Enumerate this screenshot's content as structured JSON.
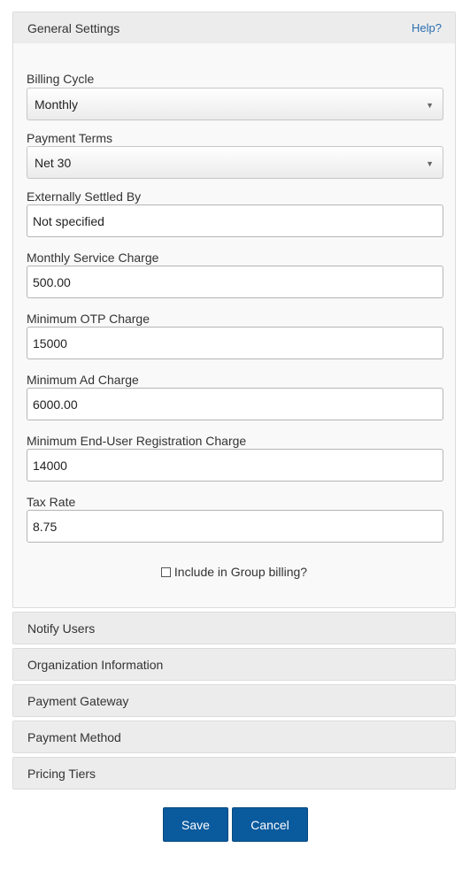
{
  "general": {
    "title": "General Settings",
    "help": "Help?",
    "billing_cycle": {
      "label": "Billing Cycle",
      "value": "Monthly"
    },
    "payment_terms": {
      "label": "Payment Terms",
      "value": "Net 30"
    },
    "settled_by": {
      "label": "Externally Settled By",
      "value": "Not specified"
    },
    "monthly_service": {
      "label": "Monthly Service Charge",
      "value": "500.00"
    },
    "min_otp": {
      "label": "Minimum OTP Charge",
      "value": "15000"
    },
    "min_ad": {
      "label": "Minimum Ad Charge",
      "value": "6000.00"
    },
    "min_registration": {
      "label": "Minimum End-User Registration Charge",
      "value": "14000"
    },
    "tax_rate": {
      "label": "Tax Rate",
      "value": "8.75"
    },
    "group_billing": {
      "label": "Include in Group billing?",
      "checked": false
    }
  },
  "sections": [
    {
      "title": "Notify Users"
    },
    {
      "title": "Organization Information"
    },
    {
      "title": "Payment Gateway"
    },
    {
      "title": "Payment Method"
    },
    {
      "title": "Pricing Tiers"
    }
  ],
  "actions": {
    "save": "Save",
    "cancel": "Cancel"
  },
  "colors": {
    "primary": "#0a5a9e",
    "link": "#2a6eb0"
  }
}
